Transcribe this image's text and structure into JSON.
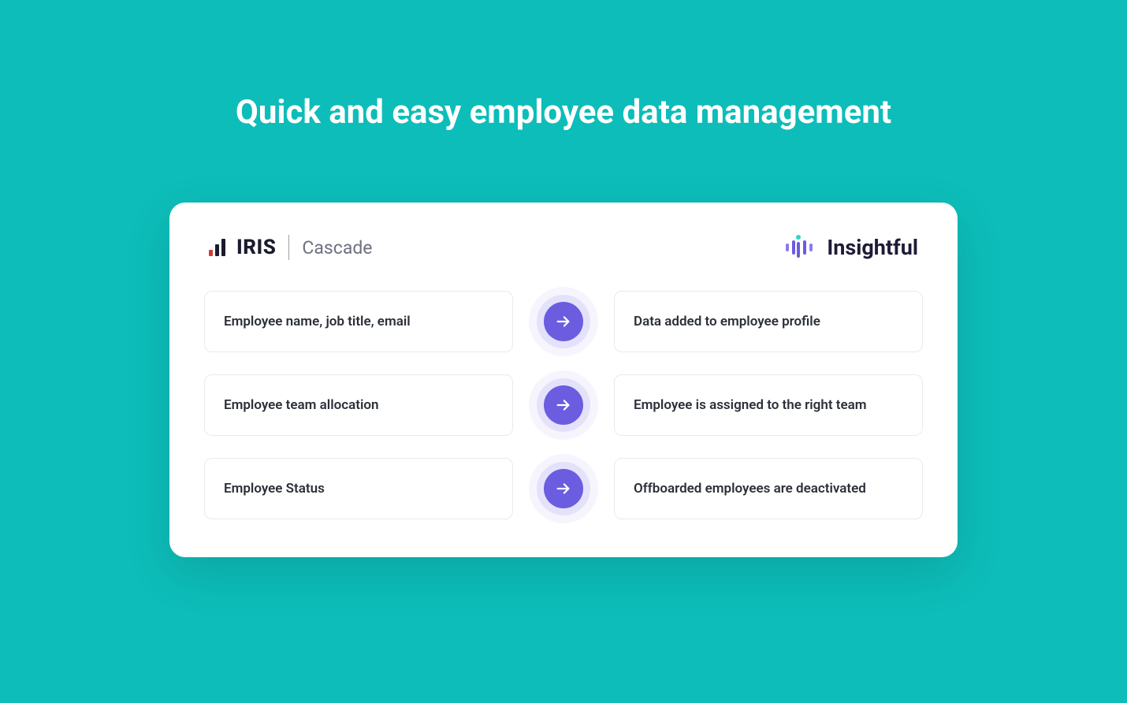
{
  "title": "Quick and easy employee data management",
  "logos": {
    "iris": "IRIS",
    "cascade": "Cascade",
    "insightful": "Insightful"
  },
  "rows": [
    {
      "left": "Employee name, job title, email",
      "right": "Data added to employee profile"
    },
    {
      "left": "Employee team allocation",
      "right": "Employee is assigned to the right team"
    },
    {
      "left": "Employee Status",
      "right": "Offboarded employees are deactivated"
    }
  ],
  "colors": {
    "background": "#0DBDB9",
    "accent": "#6B5CE0",
    "accent_light": "#E4E2FA"
  }
}
